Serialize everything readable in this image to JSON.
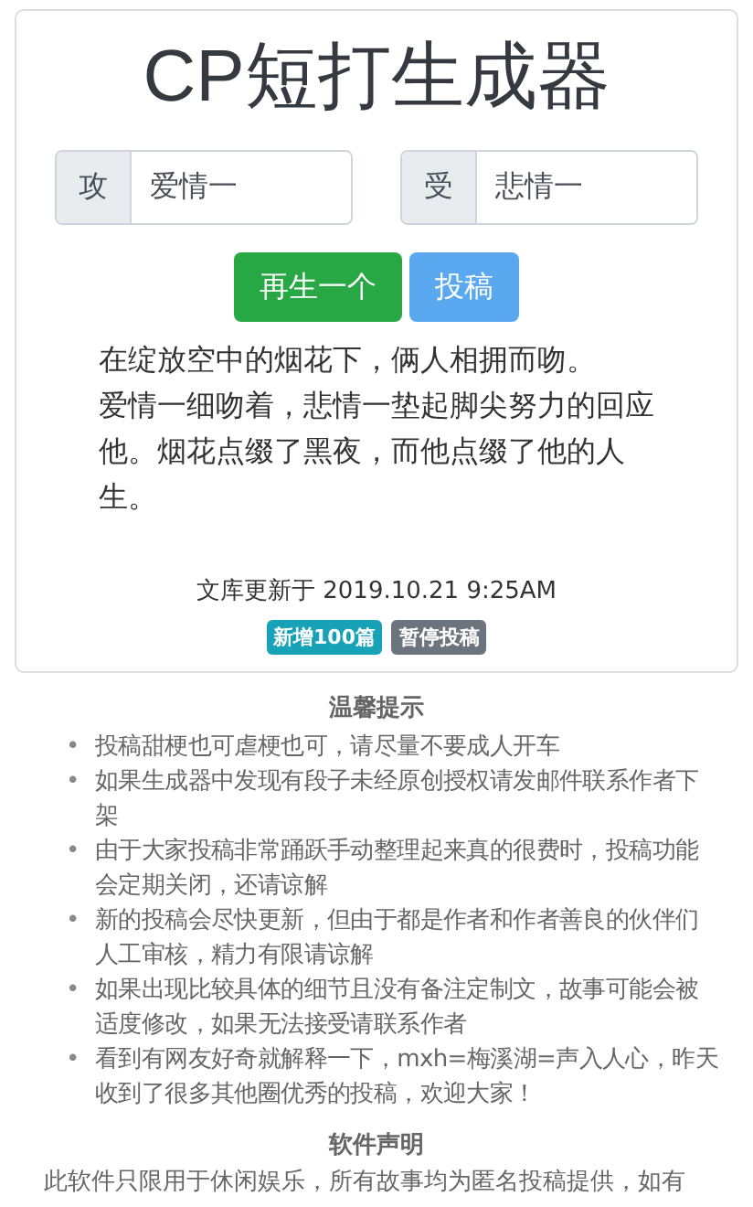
{
  "generator": {
    "title": "CP短打生成器",
    "inputs": [
      {
        "label": "攻",
        "value": "爱情一"
      },
      {
        "label": "受",
        "value": "悲情一"
      }
    ],
    "buttons": [
      {
        "label": "再生一个",
        "kind": "primary"
      },
      {
        "label": "投稿",
        "kind": "secondary"
      }
    ],
    "story": [
      "在绽放空中的烟花下，俩人相拥而吻。",
      "爱情一细吻着，悲情一垫起脚尖努力的回应他。烟花点缀了黑夜，而他点缀了他的人生。"
    ],
    "update": "文库更新于 2019.10.21 9:25AM",
    "badges": [
      {
        "label": "新增100篇",
        "color": "#17a2b8"
      },
      {
        "label": "暂停投稿",
        "color": "#6c757d"
      }
    ]
  },
  "tips": {
    "heading": "温馨提示",
    "items": [
      {
        "marker": "•",
        "text": "投稿甜梗也可虐梗也可，请尽量不要成人开车"
      },
      {
        "marker": "•",
        "text": "如果生成器中发现有段子未经原创授权请发邮件联系作者下架"
      },
      {
        "marker": "•",
        "text": "由于大家投稿非常踊跃手动整理起来真的很费时，投稿功能会定期关闭，还请谅解"
      },
      {
        "marker": "•",
        "text": "新的投稿会尽快更新，但由于都是作者和作者善良的伙伴们人工审核，精力有限请谅解"
      },
      {
        "marker": "•",
        "text": "如果出现比较具体的细节且没有备注定制文，故事可能会被适度修改，如果无法接受请联系作者"
      },
      {
        "marker": "•",
        "text": "看到有网友好奇就解释一下，mxh=梅溪湖=声入人心，昨天收到了很多其他圈优秀的投稿，欢迎大家！"
      }
    ]
  },
  "disclaimer": {
    "heading": "软件声明",
    "text": "此软件只限用于休闲娱乐，所有故事均为匿名投稿提供，如有"
  }
}
